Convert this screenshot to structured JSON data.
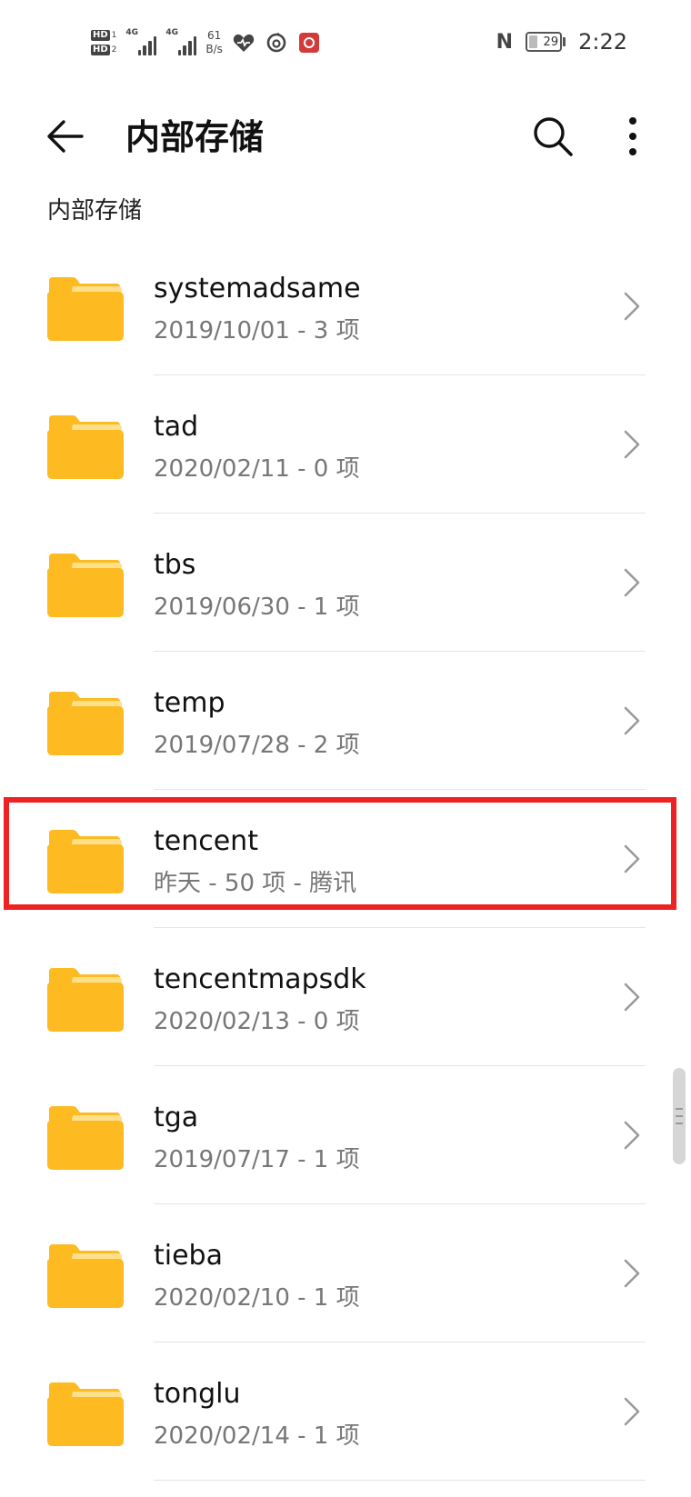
{
  "status_bar": {
    "hd1": "HD",
    "hd1_num": "1",
    "hd2": "HD",
    "hd2_num": "2",
    "net1": "4G",
    "net2": "4G",
    "speed_value": "61",
    "speed_unit": "B/s",
    "nfc": "N",
    "battery": "29",
    "battery_fill": 0.29,
    "time": "2:22"
  },
  "header": {
    "title": "内部存储",
    "back_icon": "arrow-left-icon",
    "search_icon": "search-icon",
    "more_icon": "more-vertical-icon"
  },
  "breadcrumb": "内部存储",
  "files": [
    {
      "name": "systemadsame",
      "meta": "2019/10/01 - 3 项"
    },
    {
      "name": "tad",
      "meta": "2020/02/11 - 0 项"
    },
    {
      "name": "tbs",
      "meta": "2019/06/30 - 1 项"
    },
    {
      "name": "temp",
      "meta": "2019/07/28 - 2 项"
    },
    {
      "name": "tencent",
      "meta": "昨天 - 50 项 - 腾讯"
    },
    {
      "name": "tencentmapsdk",
      "meta": "2020/02/13 - 0 项"
    },
    {
      "name": "tga",
      "meta": "2019/07/17 - 1 项"
    },
    {
      "name": "tieba",
      "meta": "2020/02/10 - 1 项"
    },
    {
      "name": "tonglu",
      "meta": "2020/02/14 - 1 项"
    }
  ],
  "colors": {
    "folder_main": "#FDBA21",
    "folder_tab": "#FFE08A",
    "highlight": "#EE2222",
    "secondary_text": "#777777"
  }
}
